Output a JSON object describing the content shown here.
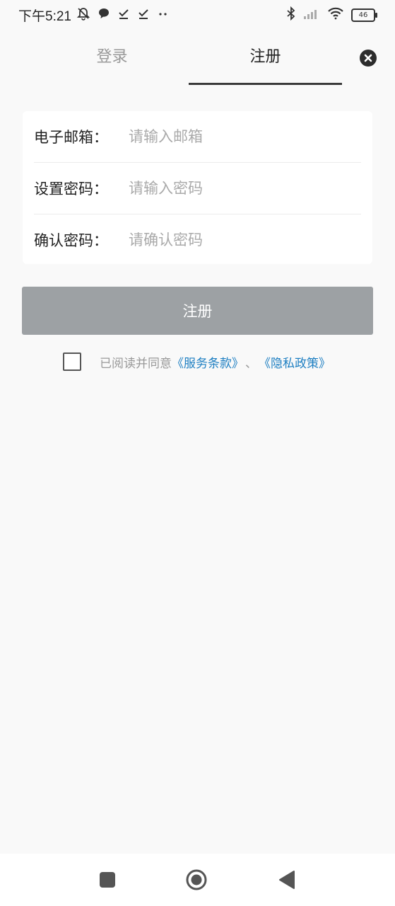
{
  "status_bar": {
    "time": "下午5:21",
    "battery": "46",
    "icons": [
      "mute-icon",
      "chat-bubble-icon",
      "download-done-icon",
      "download-done-icon",
      "more-dots-icon",
      "bluetooth-icon",
      "signal-icon",
      "wifi-icon",
      "battery-icon"
    ]
  },
  "tabs": [
    {
      "label": "登录",
      "active": false
    },
    {
      "label": "注册",
      "active": true
    }
  ],
  "form": {
    "email": {
      "label": "电子邮箱：",
      "placeholder": "请输入邮箱",
      "value": ""
    },
    "password": {
      "label": "设置密码：",
      "placeholder": "请输入密码",
      "value": ""
    },
    "confirm": {
      "label": "确认密码：",
      "placeholder": "请确认密码",
      "value": ""
    }
  },
  "submit_label": "注册",
  "agreement": {
    "checked": false,
    "prefix": "已阅读并同意",
    "terms": "《服务条款》",
    "separator": "、",
    "privacy": "《隐私政策》"
  },
  "colors": {
    "background": "#f9f9f9",
    "button_disabled": "#9da1a4",
    "link": "#1e7fc2",
    "active_tab_underline": "#3a3a3a"
  }
}
